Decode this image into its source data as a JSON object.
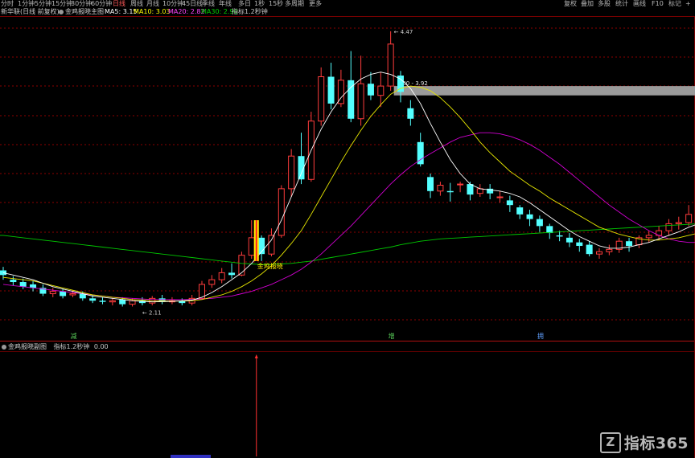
{
  "toolbar": {
    "periods": [
      {
        "label": "分时",
        "active": false
      },
      {
        "label": "1分钟",
        "active": false
      },
      {
        "label": "5分钟",
        "active": false
      },
      {
        "label": "15分钟",
        "active": false
      },
      {
        "label": "30分钟",
        "active": false
      },
      {
        "label": "60分钟",
        "active": false
      },
      {
        "label": "日线",
        "active": true
      },
      {
        "label": "周线",
        "active": false
      },
      {
        "label": "月线",
        "active": false
      },
      {
        "label": "10分钟",
        "active": false
      },
      {
        "label": "45日线",
        "active": false
      },
      {
        "label": "季线",
        "active": false
      },
      {
        "label": "年线",
        "active": false
      },
      {
        "label": "多日",
        "active": false
      },
      {
        "label": "1秒",
        "active": false
      },
      {
        "label": "15秒",
        "active": false
      },
      {
        "label": "多周期",
        "active": false
      },
      {
        "label": "更多",
        "active": false
      }
    ],
    "buttons": [
      "复权",
      "叠加",
      "多股",
      "统计",
      "画线",
      "F10",
      "标记",
      "+"
    ]
  },
  "main_legend": {
    "stock": "新华联(日线 前复权)",
    "indicator": "金鸡报晓主图",
    "ma5": "MA5: 3.15",
    "ma10": "MA10: 3.03",
    "ma20": "MA20: 2.82",
    "ma30": "MA30: 2.90",
    "note": "指标1.2秒钟"
  },
  "annotations": {
    "high": "4.47",
    "low": "2.11",
    "range": "4.00 - 3.92",
    "signal": "金鸡报晓",
    "markers": [
      "减",
      "增",
      "拥"
    ]
  },
  "sub_legend": {
    "name": "金鸡报晓副图",
    "note": "指标1.2秒钟",
    "value": "0.00"
  },
  "logo": {
    "mark": "Z",
    "text": "指标365"
  },
  "colors": {
    "up": "#ff3c3c",
    "down": "#54ffff",
    "ma5": "#ffffff",
    "ma10": "#ffff00",
    "ma20": "#ff44ff",
    "ma30": "#00d200",
    "grid": "#8b0000",
    "band": "#9a9a9a"
  },
  "chart_data": {
    "type": "candlestick",
    "y_range": [
      1.9,
      4.6
    ],
    "candles": [
      [
        2.42,
        2.38,
        2.45,
        2.34
      ],
      [
        2.34,
        2.32,
        2.37,
        2.29
      ],
      [
        2.32,
        2.28,
        2.35,
        2.26
      ],
      [
        2.3,
        2.27,
        2.33,
        2.24
      ],
      [
        2.27,
        2.22,
        2.3,
        2.2
      ],
      [
        2.22,
        2.24,
        2.27,
        2.19
      ],
      [
        2.24,
        2.2,
        2.26,
        2.18
      ],
      [
        2.21,
        2.22,
        2.25,
        2.19
      ],
      [
        2.22,
        2.18,
        2.24,
        2.16
      ],
      [
        2.18,
        2.16,
        2.21,
        2.14
      ],
      [
        2.16,
        2.15,
        2.19,
        2.13
      ],
      [
        2.15,
        2.16,
        2.18,
        2.12
      ],
      [
        2.17,
        2.13,
        2.19,
        2.11
      ],
      [
        2.13,
        2.16,
        2.18,
        2.11
      ],
      [
        2.16,
        2.14,
        2.19,
        2.12
      ],
      [
        2.14,
        2.18,
        2.2,
        2.12
      ],
      [
        2.18,
        2.15,
        2.21,
        2.13
      ],
      [
        2.15,
        2.16,
        2.19,
        2.13
      ],
      [
        2.16,
        2.14,
        2.18,
        2.12
      ],
      [
        2.14,
        2.18,
        2.21,
        2.12
      ],
      [
        2.18,
        2.3,
        2.33,
        2.17
      ],
      [
        2.3,
        2.34,
        2.38,
        2.27
      ],
      [
        2.34,
        2.4,
        2.44,
        2.31
      ],
      [
        2.4,
        2.38,
        2.48,
        2.35
      ],
      [
        2.38,
        2.55,
        2.58,
        2.37
      ],
      [
        2.55,
        2.7,
        2.85,
        2.52
      ],
      [
        2.7,
        2.56,
        2.72,
        2.5
      ],
      [
        2.56,
        2.72,
        2.78,
        2.54
      ],
      [
        2.72,
        3.12,
        3.15,
        2.7
      ],
      [
        3.12,
        3.4,
        3.46,
        3.05
      ],
      [
        3.4,
        3.2,
        3.6,
        3.16
      ],
      [
        3.2,
        3.7,
        3.78,
        3.18
      ],
      [
        3.7,
        4.08,
        4.16,
        3.66
      ],
      [
        4.08,
        3.85,
        4.2,
        3.8
      ],
      [
        3.85,
        4.05,
        4.14,
        3.82
      ],
      [
        4.05,
        3.72,
        4.3,
        3.69
      ],
      [
        3.72,
        4.02,
        4.26,
        3.66
      ],
      [
        4.02,
        3.92,
        4.12,
        3.88
      ],
      [
        3.92,
        4.0,
        4.12,
        3.82
      ],
      [
        4.0,
        4.36,
        4.47,
        3.96
      ],
      [
        4.09,
        3.95,
        4.13,
        3.86
      ],
      [
        3.81,
        3.72,
        3.88,
        3.66
      ],
      [
        3.52,
        3.33,
        3.6,
        3.31
      ],
      [
        3.22,
        3.1,
        3.25,
        3.04
      ],
      [
        3.1,
        3.15,
        3.18,
        3.06
      ],
      [
        3.1,
        3.09,
        3.17,
        3.01
      ],
      [
        3.16,
        3.16,
        3.18,
        3.09
      ],
      [
        3.16,
        3.07,
        3.18,
        3.02
      ],
      [
        3.08,
        3.12,
        3.16,
        3.05
      ],
      [
        3.12,
        3.08,
        3.16,
        3.03
      ],
      [
        3.05,
        3.05,
        3.1,
        3.0
      ],
      [
        3.02,
        2.98,
        3.06,
        2.92
      ],
      [
        2.96,
        2.9,
        2.98,
        2.86
      ],
      [
        2.9,
        2.86,
        2.94,
        2.8
      ],
      [
        2.86,
        2.8,
        2.89,
        2.75
      ],
      [
        2.8,
        2.74,
        2.82,
        2.69
      ],
      [
        2.72,
        2.71,
        2.76,
        2.67
      ],
      [
        2.7,
        2.66,
        2.74,
        2.62
      ],
      [
        2.66,
        2.63,
        2.69,
        2.58
      ],
      [
        2.64,
        2.56,
        2.67,
        2.54
      ],
      [
        2.56,
        2.58,
        2.61,
        2.52
      ],
      [
        2.58,
        2.6,
        2.64,
        2.55
      ],
      [
        2.6,
        2.67,
        2.7,
        2.57
      ],
      [
        2.67,
        2.63,
        2.7,
        2.58
      ],
      [
        2.64,
        2.7,
        2.72,
        2.61
      ],
      [
        2.7,
        2.72,
        2.76,
        2.66
      ],
      [
        2.72,
        2.76,
        2.8,
        2.68
      ],
      [
        2.76,
        2.82,
        2.86,
        2.72
      ],
      [
        2.82,
        2.83,
        2.88,
        2.77
      ],
      [
        2.83,
        2.9,
        2.98,
        2.8
      ],
      [
        2.9,
        2.8,
        2.96,
        2.77
      ],
      [
        2.8,
        3.05,
        3.1,
        2.78
      ],
      [
        3.05,
        3.2,
        3.5,
        3.0
      ],
      [
        3.2,
        3.32,
        3.41,
        3.15
      ],
      [
        3.32,
        3.14,
        3.39,
        3.1
      ],
      [
        3.14,
        3.16,
        3.22,
        3.08
      ],
      [
        3.14,
        3.08,
        3.18,
        3.03
      ]
    ],
    "ma5": [
      2.4,
      2.38,
      2.36,
      2.34,
      2.31,
      2.28,
      2.26,
      2.24,
      2.22,
      2.2,
      2.19,
      2.18,
      2.17,
      2.16,
      2.155,
      2.15,
      2.152,
      2.155,
      2.16,
      2.165,
      2.19,
      2.23,
      2.28,
      2.34,
      2.4,
      2.48,
      2.58,
      2.68,
      2.85,
      3.05,
      3.25,
      3.45,
      3.63,
      3.78,
      3.9,
      3.99,
      4.06,
      4.1,
      4.12,
      4.1,
      4.06,
      3.98,
      3.85,
      3.68,
      3.52,
      3.37,
      3.25,
      3.16,
      3.12,
      3.11,
      3.1,
      3.08,
      3.05,
      3.0,
      2.94,
      2.88,
      2.82,
      2.76,
      2.71,
      2.67,
      2.63,
      2.61,
      2.61,
      2.62,
      2.64,
      2.66,
      2.69,
      2.72,
      2.75,
      2.79,
      2.82,
      2.87,
      2.94,
      3.03,
      3.1,
      3.14,
      3.15
    ],
    "ma10": [
      2.36,
      2.35,
      2.34,
      2.33,
      2.31,
      2.29,
      2.27,
      2.25,
      2.23,
      2.21,
      2.2,
      2.19,
      2.18,
      2.17,
      2.165,
      2.16,
      2.158,
      2.157,
      2.157,
      2.16,
      2.17,
      2.19,
      2.21,
      2.24,
      2.28,
      2.33,
      2.39,
      2.46,
      2.55,
      2.65,
      2.76,
      2.9,
      3.05,
      3.2,
      3.35,
      3.49,
      3.62,
      3.74,
      3.84,
      3.93,
      3.98,
      4.0,
      3.99,
      3.96,
      3.9,
      3.82,
      3.73,
      3.63,
      3.52,
      3.43,
      3.35,
      3.27,
      3.21,
      3.15,
      3.1,
      3.04,
      2.99,
      2.94,
      2.89,
      2.84,
      2.79,
      2.76,
      2.73,
      2.71,
      2.69,
      2.68,
      2.68,
      2.69,
      2.7,
      2.72,
      2.74,
      2.77,
      2.81,
      2.87,
      2.93,
      2.98,
      3.03
    ],
    "ma20": [
      2.3,
      2.29,
      2.28,
      2.27,
      2.26,
      2.25,
      2.24,
      2.23,
      2.22,
      2.21,
      2.2,
      2.19,
      2.185,
      2.18,
      2.175,
      2.17,
      2.17,
      2.17,
      2.17,
      2.17,
      2.175,
      2.18,
      2.19,
      2.2,
      2.22,
      2.24,
      2.27,
      2.3,
      2.34,
      2.38,
      2.43,
      2.49,
      2.56,
      2.64,
      2.72,
      2.8,
      2.89,
      2.98,
      3.07,
      3.16,
      3.24,
      3.31,
      3.37,
      3.42,
      3.47,
      3.52,
      3.56,
      3.58,
      3.6,
      3.6,
      3.59,
      3.57,
      3.54,
      3.5,
      3.45,
      3.39,
      3.33,
      3.26,
      3.19,
      3.12,
      3.05,
      2.98,
      2.92,
      2.86,
      2.81,
      2.76,
      2.72,
      2.69,
      2.67,
      2.66,
      2.66,
      2.67,
      2.69,
      2.71,
      2.75,
      2.79,
      2.82
    ],
    "ma30": [
      2.72,
      2.71,
      2.7,
      2.69,
      2.68,
      2.67,
      2.66,
      2.65,
      2.64,
      2.63,
      2.62,
      2.61,
      2.6,
      2.59,
      2.58,
      2.57,
      2.56,
      2.55,
      2.54,
      2.53,
      2.52,
      2.51,
      2.5,
      2.49,
      2.48,
      2.475,
      2.47,
      2.47,
      2.475,
      2.48,
      2.49,
      2.5,
      2.515,
      2.53,
      2.545,
      2.56,
      2.575,
      2.59,
      2.605,
      2.62,
      2.64,
      2.655,
      2.67,
      2.68,
      2.69,
      2.695,
      2.7,
      2.705,
      2.71,
      2.715,
      2.72,
      2.725,
      2.73,
      2.735,
      2.74,
      2.745,
      2.75,
      2.755,
      2.76,
      2.765,
      2.77,
      2.775,
      2.78,
      2.785,
      2.79,
      2.795,
      2.8,
      2.805,
      2.81,
      2.815,
      2.82,
      2.83,
      2.84,
      2.85,
      2.865,
      2.88,
      2.9
    ]
  }
}
